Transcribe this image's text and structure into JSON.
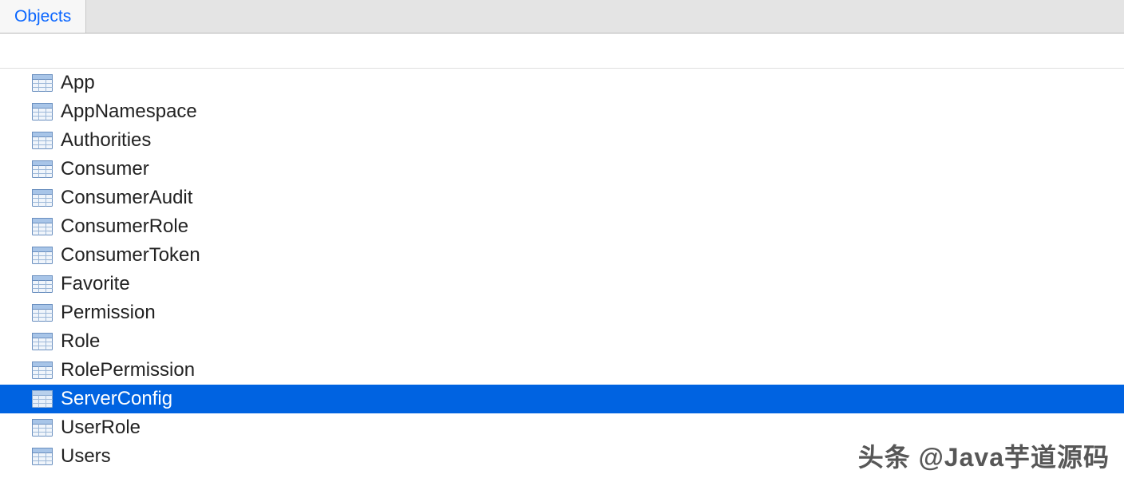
{
  "tabs": {
    "active": "Objects"
  },
  "items": [
    {
      "label": "App",
      "selected": false
    },
    {
      "label": "AppNamespace",
      "selected": false
    },
    {
      "label": "Authorities",
      "selected": false
    },
    {
      "label": "Consumer",
      "selected": false
    },
    {
      "label": "ConsumerAudit",
      "selected": false
    },
    {
      "label": "ConsumerRole",
      "selected": false
    },
    {
      "label": "ConsumerToken",
      "selected": false
    },
    {
      "label": "Favorite",
      "selected": false
    },
    {
      "label": "Permission",
      "selected": false
    },
    {
      "label": "Role",
      "selected": false
    },
    {
      "label": "RolePermission",
      "selected": false
    },
    {
      "label": "ServerConfig",
      "selected": true
    },
    {
      "label": "UserRole",
      "selected": false
    },
    {
      "label": "Users",
      "selected": false
    }
  ],
  "watermark": "头条 @Java芋道源码"
}
